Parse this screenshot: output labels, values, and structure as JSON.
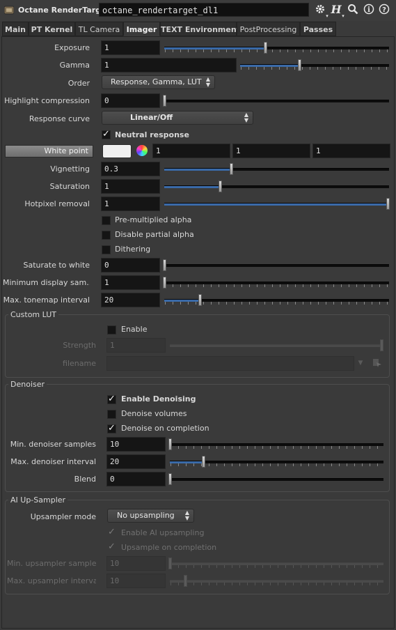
{
  "header": {
    "node_type": "Octane RenderTarget",
    "node_name": "octane_rendertarget_dl1",
    "icons": [
      "gear-icon",
      "houdini-help-icon",
      "search-icon",
      "info-icon",
      "help-icon"
    ]
  },
  "tabs": [
    {
      "label": "Main",
      "active": false
    },
    {
      "label": "PT Kernel",
      "active": false
    },
    {
      "label": "TL Camera",
      "active": false
    },
    {
      "label": "Imager",
      "active": true
    },
    {
      "label": "TEXT Environment",
      "active": false
    },
    {
      "label": "PostProcessing",
      "active": false
    },
    {
      "label": "Passes",
      "active": false
    }
  ],
  "imager": {
    "exposure": {
      "label": "Exposure",
      "value": "1"
    },
    "gamma": {
      "label": "Gamma",
      "value": "1"
    },
    "order": {
      "label": "Order",
      "value": "Response, Gamma, LUT"
    },
    "highlight_compression": {
      "label": "Highlight compression",
      "value": "0"
    },
    "response_curve": {
      "label": "Response curve",
      "value": "Linear/Off"
    },
    "neutral_response": {
      "label": "Neutral response",
      "checked": true
    },
    "white_point": {
      "label": "White point",
      "r": "1",
      "g": "1",
      "b": "1",
      "swatch_color": "#f0f0f0"
    },
    "vignetting": {
      "label": "Vignetting",
      "value": "0.3"
    },
    "saturation": {
      "label": "Saturation",
      "value": "1"
    },
    "hotpixel_removal": {
      "label": "Hotpixel removal",
      "value": "1"
    },
    "pre_multiplied_alpha": {
      "label": "Pre-multiplied alpha",
      "checked": false
    },
    "disable_partial_alpha": {
      "label": "Disable partial alpha",
      "checked": false
    },
    "dithering": {
      "label": "Dithering",
      "checked": false
    },
    "saturate_to_white": {
      "label": "Saturate to white",
      "value": "0"
    },
    "min_display_samples": {
      "label": "Minimum display sam...",
      "value": "1"
    },
    "max_tonemap_interval": {
      "label": "Max. tonemap interval",
      "value": "20"
    }
  },
  "custom_lut": {
    "title": "Custom LUT",
    "enable": {
      "label": "Enable",
      "checked": false
    },
    "strength": {
      "label": "Strength",
      "value": "1"
    },
    "filename": {
      "label": "filename",
      "value": ""
    }
  },
  "denoiser": {
    "title": "Denoiser",
    "enable_denoising": {
      "label": "Enable Denoising",
      "checked": true
    },
    "denoise_volumes": {
      "label": "Denoise volumes",
      "checked": false
    },
    "denoise_on_completion": {
      "label": "Denoise on completion",
      "checked": true
    },
    "min_samples": {
      "label": "Min. denoiser samples",
      "value": "10"
    },
    "max_interval": {
      "label": "Max. denoiser interval",
      "value": "20"
    },
    "blend": {
      "label": "Blend",
      "value": "0"
    }
  },
  "upsampler": {
    "title": "AI Up-Sampler",
    "mode": {
      "label": "Upsampler mode",
      "value": "No upsampling"
    },
    "enable_ai": {
      "label": "Enable AI upsampling",
      "checked": true
    },
    "upsample_on_completion": {
      "label": "Upsample on completion",
      "checked": true
    },
    "min_samples": {
      "label": "Min. upsampler samples",
      "value": "10"
    },
    "max_interval": {
      "label": "Max. upsampler interval",
      "value": "10"
    }
  },
  "colors": {
    "accent": "#3a6aa8",
    "field_bg": "#151515",
    "panel_bg": "#3a3a3a"
  }
}
